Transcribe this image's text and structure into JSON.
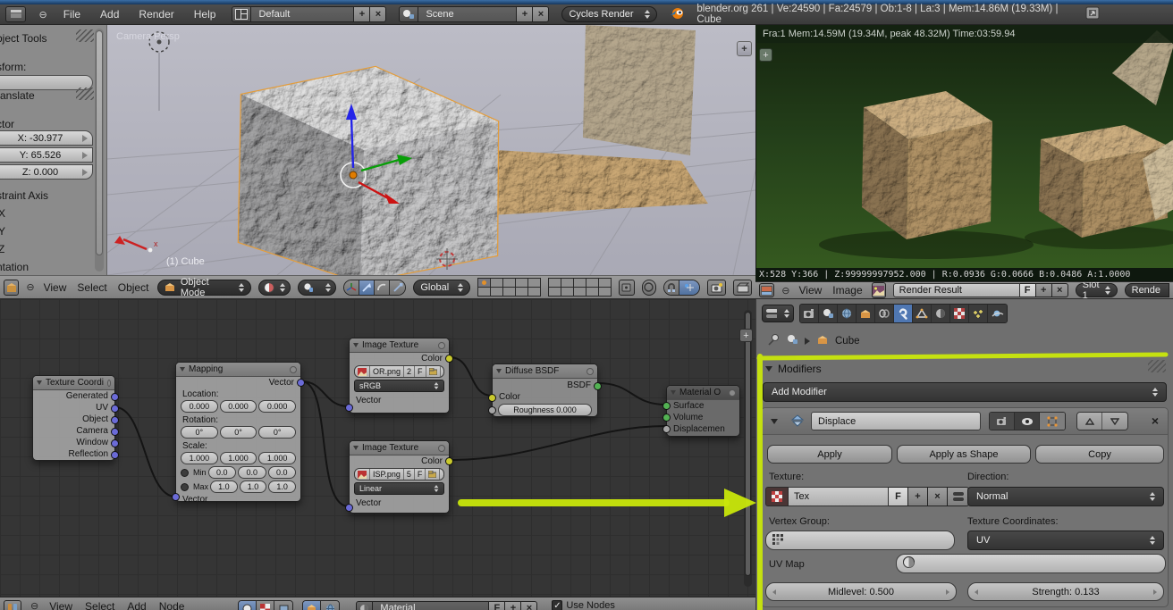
{
  "glyphs": {
    "close": "×",
    "plus": "+",
    "minus": "−",
    "check": "✓",
    "f": "F"
  },
  "colors": {
    "accent_tab": "#4f77b2",
    "annotation": "#c9e70b",
    "selection_outline": "#e39d3c"
  },
  "topbar": {
    "menus": [
      "File",
      "Add",
      "Render",
      "Help"
    ],
    "layout_name": "Default",
    "scene_name": "Scene",
    "engine": "Cycles Render",
    "stats": "blender.org 261 | Ve:24590 | Fa:24579 | Ob:1-8 | La:3 | Mem:14.86M (19.33M) | Cube"
  },
  "tool_shelf": {
    "panel_title": "bject Tools",
    "transform_label": "sform:",
    "translate_title": "ranslate",
    "vector_label": "ctor",
    "x": "X: -30.977",
    "y": "Y: 65.526",
    "z": "Z: 0.000",
    "constraint_label": "straint Axis",
    "axis_x": "X",
    "axis_y": "Y",
    "axis_z": "Z",
    "orientation_label": "ntation"
  },
  "viewport": {
    "view_label": "Camera Persp",
    "object_label": "(1) Cube",
    "menus": [
      "View",
      "Select",
      "Object"
    ],
    "mode": "Object Mode",
    "orientation": "Global"
  },
  "node_editor": {
    "menus": [
      "View",
      "Select",
      "Add",
      "Node"
    ],
    "material_name": "Material",
    "use_nodes": "Use Nodes",
    "texture_coordinate": {
      "title": "Texture Coordi",
      "outputs": [
        "Generated",
        "UV",
        "Object",
        "Camera",
        "Window",
        "Reflection"
      ]
    },
    "mapping": {
      "title": "Mapping",
      "output": "Vector",
      "input": "Vector",
      "location_label": "Location:",
      "location": [
        "0.000",
        "0.000",
        "0.000"
      ],
      "rotation_label": "Rotation:",
      "rotation": [
        "0°",
        "0°",
        "0°"
      ],
      "scale_label": "Scale:",
      "scale": [
        "1.000",
        "1.000",
        "1.000"
      ],
      "min_label": "Min",
      "min": [
        "0.0",
        "0.0",
        "0.0"
      ],
      "max_label": "Max",
      "max": [
        "1.0",
        "1.0",
        "1.0"
      ]
    },
    "image_texture_1": {
      "title": "Image Texture",
      "output": "Color",
      "file": "OR.png",
      "users": "2",
      "colorspace": "sRGB",
      "input": "Vector"
    },
    "image_texture_2": {
      "title": "Image Texture",
      "output": "Color",
      "file": "ISP.png",
      "users": "5",
      "colorspace": "Linear",
      "input": "Vector"
    },
    "diffuse": {
      "title": "Diffuse BSDF",
      "output": "BSDF",
      "input_color": "Color",
      "roughness": "Roughness 0.000"
    },
    "material_output": {
      "title": "Material O",
      "inputs": [
        "Surface",
        "Volume",
        "Displacemen"
      ]
    }
  },
  "render_view": {
    "stats": "Fra:1  Mem:14.59M (19.34M, peak 48.32M) Time:03:59.94",
    "footer": "X:528   Y:366   | Z:99999997952.000 |  R:0.0936  G:0.0666  B:0.0486  A:1.0000",
    "menus": [
      "View",
      "Image"
    ],
    "image_name": "Render Result",
    "slot": "Slot 1",
    "render_slot": "Rende"
  },
  "properties": {
    "breadcrumb": "Cube",
    "panel_title": "Modifiers",
    "add_modifier": "Add Modifier",
    "modifier": {
      "name": "Displace",
      "apply": "Apply",
      "apply_as_shape": "Apply as Shape",
      "copy": "Copy",
      "texture_label": "Texture:",
      "texture_name": "Tex",
      "direction_label": "Direction:",
      "direction": "Normal",
      "vertex_group_label": "Vertex Group:",
      "texcoord_label": "Texture Coordinates:",
      "texcoord": "UV",
      "uv_map_label": "UV Map",
      "midlevel": "Midlevel: 0.500",
      "strength": "Strength: 0.133"
    }
  }
}
